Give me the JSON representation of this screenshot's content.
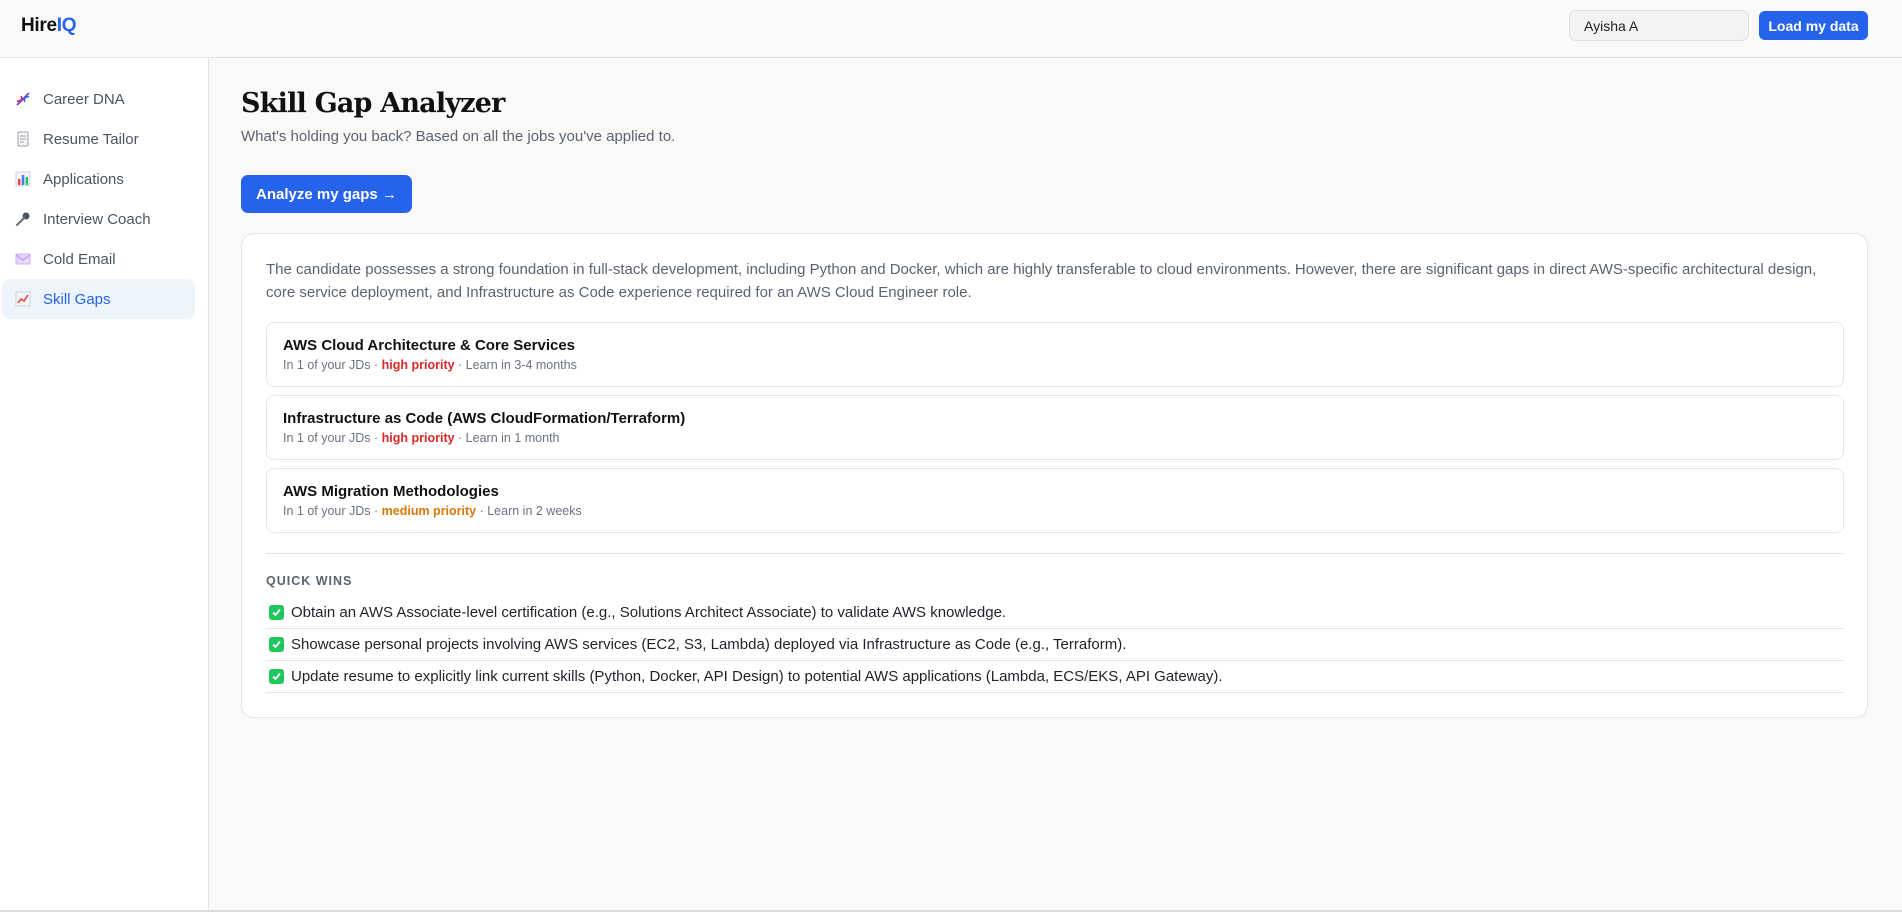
{
  "header": {
    "logo_main": "Hire",
    "logo_accent": "IQ",
    "user_name": "Ayisha A",
    "load_label": "Load my data"
  },
  "sidebar": {
    "items": [
      {
        "label": "Career DNA",
        "icon": "dna-icon",
        "active": false
      },
      {
        "label": "Resume Tailor",
        "icon": "document-icon",
        "active": false
      },
      {
        "label": "Applications",
        "icon": "bar-chart-icon",
        "active": false
      },
      {
        "label": "Interview Coach",
        "icon": "microphone-icon",
        "active": false
      },
      {
        "label": "Cold Email",
        "icon": "envelope-icon",
        "active": false
      },
      {
        "label": "Skill Gaps",
        "icon": "trend-chart-icon",
        "active": true
      }
    ]
  },
  "main": {
    "title": "Skill Gap Analyzer",
    "subtitle": "What's holding you back? Based on all the jobs you've applied to.",
    "analyze_label": "Analyze my gaps →",
    "summary": "The candidate possesses a strong foundation in full-stack development, including Python and Docker, which are highly transferable to cloud environments. However, there are significant gaps in direct AWS-specific architectural design, core service deployment, and Infrastructure as Code experience required for an AWS Cloud Engineer role.",
    "gaps": [
      {
        "title": "AWS Cloud Architecture & Core Services",
        "jd_text": "In 1 of your JDs · ",
        "priority": "high priority",
        "priority_color": "#dc2626",
        "learn": " · Learn in 3-4 months"
      },
      {
        "title": "Infrastructure as Code (AWS CloudFormation/Terraform)",
        "jd_text": "In 1 of your JDs · ",
        "priority": "high priority",
        "priority_color": "#dc2626",
        "learn": " · Learn in 1 month"
      },
      {
        "title": "AWS Migration Methodologies",
        "jd_text": "In 1 of your JDs · ",
        "priority": "medium priority",
        "priority_color": "#d97706",
        "learn": " · Learn in 2 weeks"
      }
    ],
    "quick_wins_heading": "QUICK WINS",
    "quick_wins": [
      "Obtain an AWS Associate-level certification (e.g., Solutions Architect Associate) to validate AWS knowledge.",
      "Showcase personal projects involving AWS services (EC2, S3, Lambda) deployed via Infrastructure as Code (e.g., Terraform).",
      "Update resume to explicitly link current skills (Python, Docker, API Design) to potential AWS applications (Lambda, ECS/EKS, API Gateway)."
    ]
  },
  "colors": {
    "accent": "#2563eb",
    "active_bg": "#eef4fc",
    "high_priority": "#dc2626",
    "medium_priority": "#d97706",
    "check": "#22c55e"
  }
}
